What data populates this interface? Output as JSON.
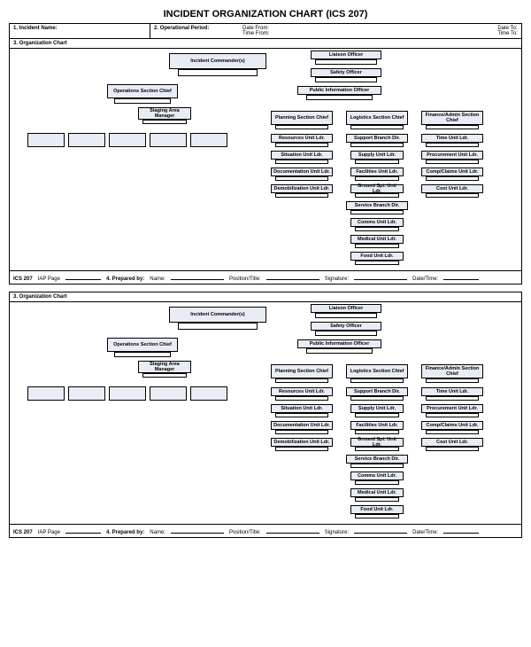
{
  "title": "INCIDENT ORGANIZATION CHART (ICS 207)",
  "header": {
    "incident_name_label": "1. Incident Name:",
    "op_period_label": "2. Operational Period:",
    "date_from": "Date From:",
    "date_to": "Date To:",
    "time_from": "Time From:",
    "time_to": "Time To:"
  },
  "section_label": "3. Organization Chart",
  "boxes": {
    "incident_commander": "Incident Commander(s)",
    "liaison": "Liaison Officer",
    "safety": "Safety Officer",
    "pio": "Public Information Officer",
    "ops_chief": "Operations Section Chief",
    "staging": "Staging Area Manager",
    "planning_chief": "Planning Section Chief",
    "logistics_chief": "Logistics Section Chief",
    "finance_chief": "Finance/Admin Section Chief",
    "resources": "Resources Unit Ldr.",
    "situation": "Situation Unit Ldr.",
    "documentation": "Documentation Unit Ldr.",
    "demob": "Demobilization Unit Ldr.",
    "support_branch": "Support Branch Dir.",
    "supply": "Supply Unit Ldr.",
    "facilities": "Facilities Unit Ldr.",
    "ground": "Ground Spt. Unit Ldr.",
    "service_branch": "Service Branch Dir.",
    "comms": "Comms Unit Ldr.",
    "medical": "Medical Unit Ldr.",
    "food": "Food Unit Ldr.",
    "time": "Time Unit Ldr.",
    "procurement": "Procurement Unit Ldr.",
    "comp": "Comp/Claims Unit Ldr.",
    "cost": "Cost Unit Ldr."
  },
  "footer": {
    "ics": "ICS 207",
    "iap_page": "IAP Page",
    "prepared": "4. Prepared by:",
    "name": "Name:",
    "position": "Position/Title:",
    "signature": "Signature:",
    "datetime": "Date/Time:"
  }
}
